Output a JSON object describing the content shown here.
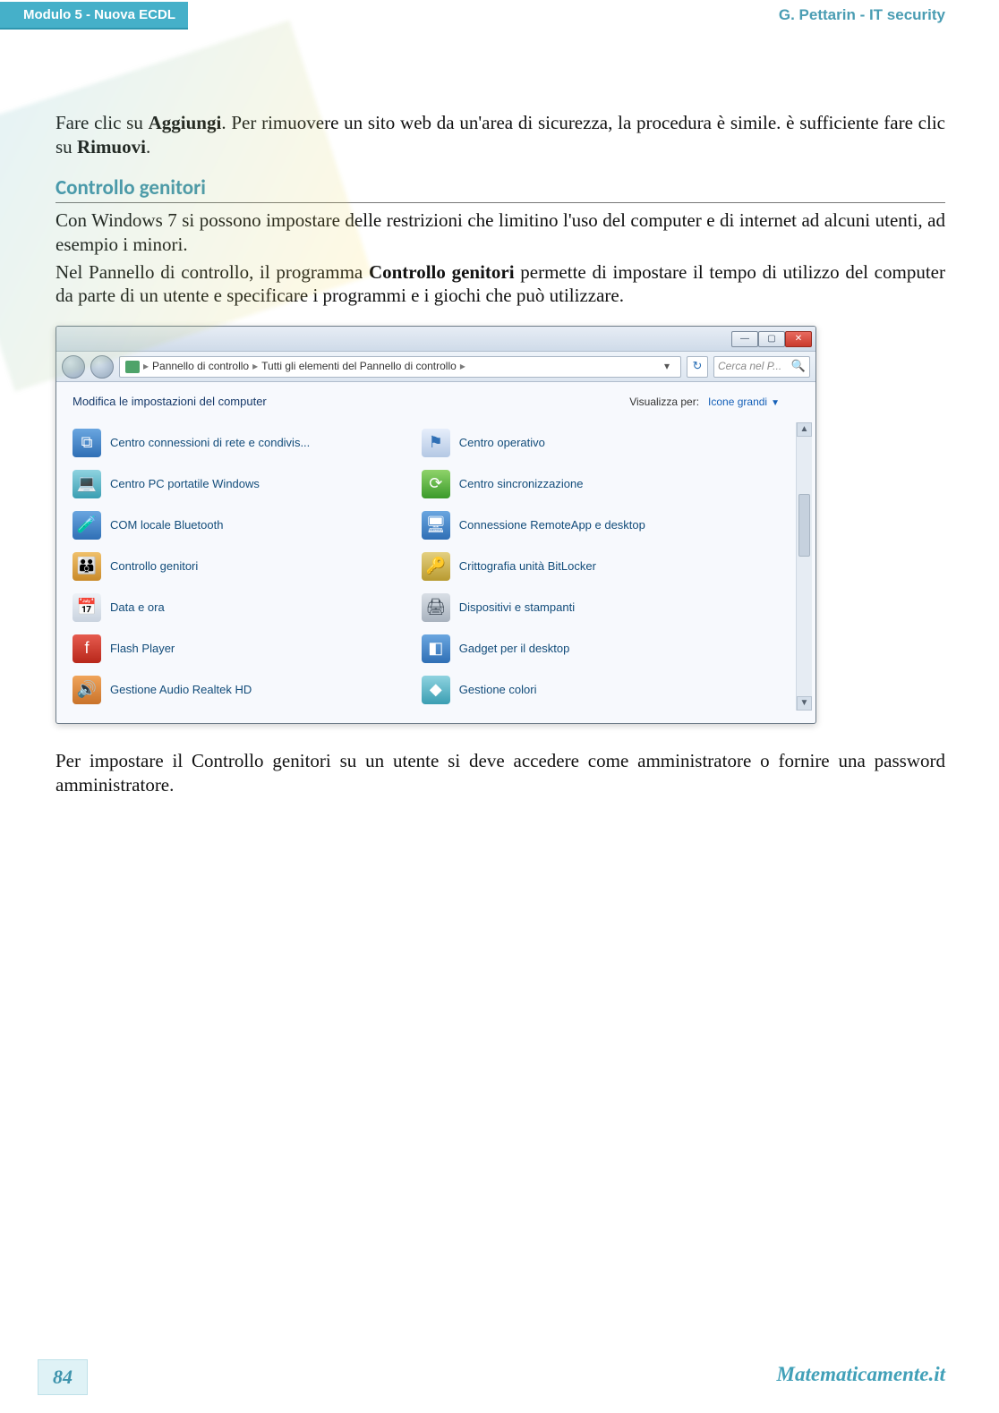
{
  "header": {
    "module": "Modulo 5 - Nuova ECDL",
    "author": "G. Pettarin - IT security"
  },
  "intro": {
    "p1a": "Fare clic su ",
    "p1b": "Aggiungi",
    "p1c": ". Per rimuovere un sito web da un'area di sicurezza, la procedura è simile. è sufficiente fare clic su ",
    "p1d": "Rimuovi",
    "p1e": "."
  },
  "section_title": "Controllo genitori",
  "body": {
    "p2": "Con Windows 7 si possono impostare delle restrizioni che limitino l'uso del computer e di internet ad alcuni utenti, ad esempio i minori.",
    "p3a": "Nel Pannello di controllo, il programma ",
    "p3b": "Controllo genitori",
    "p3c": " permette di impostare il tempo di utilizzo del computer da parte di un utente e specificare i programmi e i giochi che può utilizzare."
  },
  "window": {
    "breadcrumb": {
      "root": "",
      "part1": "Pannello di controllo",
      "part2": "Tutti gli elementi del Pannello di controllo"
    },
    "search_placeholder": "Cerca nel P...",
    "heading": "Modifica le impostazioni del computer",
    "view_label": "Visualizza per:",
    "view_value": "Icone grandi",
    "items_left": [
      {
        "label": "Centro connessioni di rete e condivis...",
        "icon": "i-blue",
        "glyph": "⧉",
        "name": "network-center"
      },
      {
        "label": "Centro PC portatile Windows",
        "icon": "i-teal",
        "glyph": "💻",
        "name": "mobility-center"
      },
      {
        "label": "COM locale Bluetooth",
        "icon": "i-blue",
        "glyph": "🧪",
        "name": "bluetooth-com"
      },
      {
        "label": "Controllo genitori",
        "icon": "i-fam",
        "glyph": "👪",
        "name": "parental-controls"
      },
      {
        "label": "Data e ora",
        "icon": "i-cal",
        "glyph": "📅",
        "name": "date-time"
      },
      {
        "label": "Flash Player",
        "icon": "i-red",
        "glyph": "f",
        "name": "flash-player"
      },
      {
        "label": "Gestione Audio Realtek HD",
        "icon": "i-org",
        "glyph": "🔊",
        "name": "realtek-audio"
      }
    ],
    "items_right": [
      {
        "label": "Centro operativo",
        "icon": "i-flag",
        "glyph": "⚑",
        "name": "action-center"
      },
      {
        "label": "Centro sincronizzazione",
        "icon": "i-grn",
        "glyph": "⟳",
        "name": "sync-center"
      },
      {
        "label": "Connessione RemoteApp e desktop",
        "icon": "i-blue",
        "glyph": "🖥",
        "name": "remoteapp"
      },
      {
        "label": "Crittografia unità BitLocker",
        "icon": "i-key",
        "glyph": "🔑",
        "name": "bitlocker"
      },
      {
        "label": "Dispositivi e stampanti",
        "icon": "i-prn",
        "glyph": "🖨",
        "name": "devices-printers"
      },
      {
        "label": "Gadget per il desktop",
        "icon": "i-blue",
        "glyph": "◧",
        "name": "desktop-gadgets"
      },
      {
        "label": "Gestione colori",
        "icon": "i-teal",
        "glyph": "◆",
        "name": "color-management"
      }
    ]
  },
  "body2": {
    "p4": "Per impostare il Controllo genitori su un utente si deve accedere come amministratore o fornire una password amministratore."
  },
  "footer": {
    "page": "84",
    "site": "Matematicamente.it"
  }
}
